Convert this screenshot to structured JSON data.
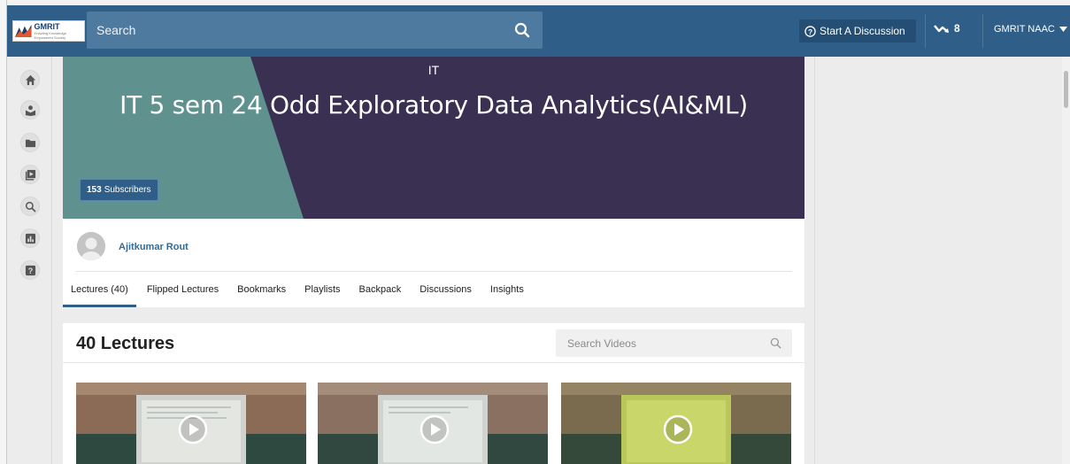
{
  "header": {
    "logo_text": "GMRIT",
    "logo_subtext": "Enabling Knowledge Empowered Society",
    "search_placeholder": "Search",
    "start_discussion": "Start A Discussion",
    "trend_count": "8",
    "user_menu": "GMRIT NAAC"
  },
  "sidebar": {
    "items": [
      "home-icon",
      "learner-icon",
      "folder-icon",
      "playlist-icon",
      "search-icon",
      "insights-icon",
      "help-icon"
    ]
  },
  "banner": {
    "category": "IT",
    "title": "IT 5 sem 24 Odd Exploratory Data Analytics(AI&ML)",
    "subscribers_count": "153",
    "subscribers_label": "Subscribers"
  },
  "author": {
    "name": "Ajitkumar Rout"
  },
  "tabs": [
    "Lectures (40)",
    "Flipped Lectures",
    "Bookmarks",
    "Playlists",
    "Backpack",
    "Discussions",
    "Insights"
  ],
  "lectures": {
    "heading": "40 Lectures",
    "search_placeholder": "Search Videos"
  },
  "colors": {
    "header": "#2f5f88",
    "banner_purple": "#3a3052",
    "banner_teal": "#5b8f8c",
    "accent": "#2f6c9a"
  }
}
